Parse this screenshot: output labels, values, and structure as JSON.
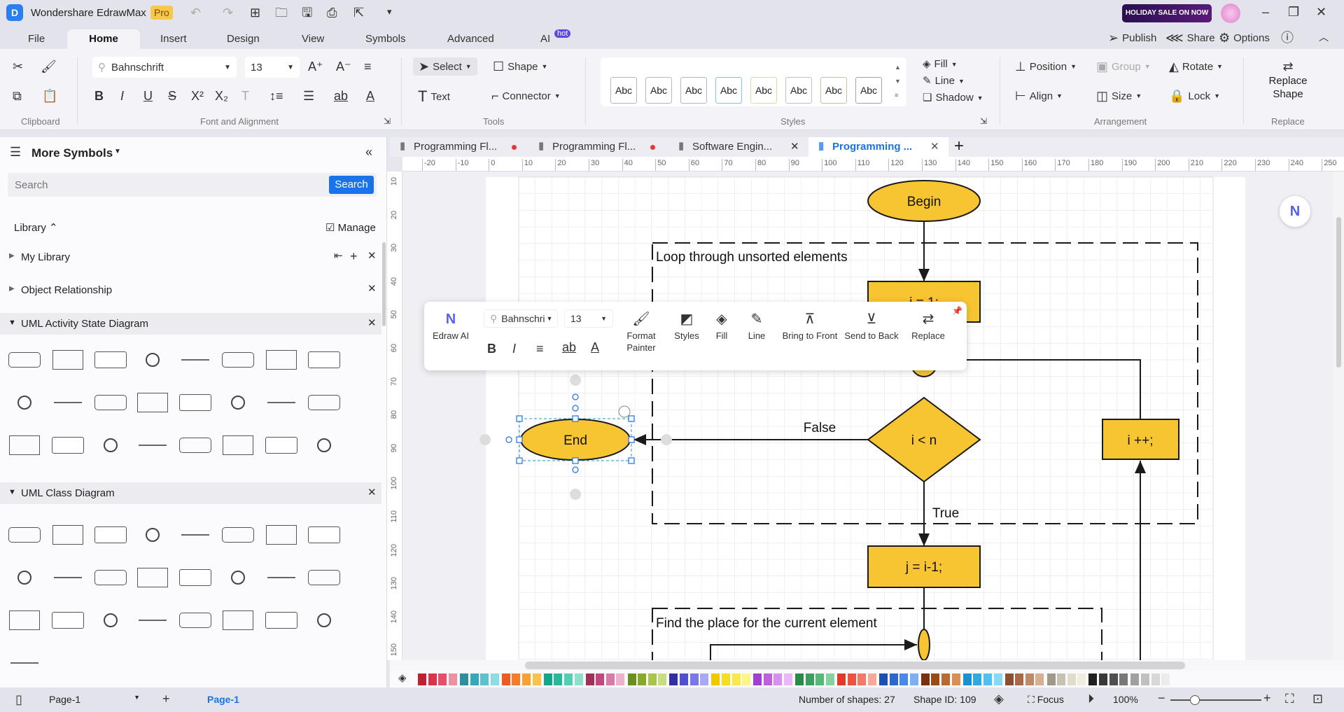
{
  "app": {
    "title": "Wondershare EdrawMax",
    "badge": "Pro",
    "promo": "HOLIDAY SALE ON NOW"
  },
  "menu": {
    "tabs": [
      "File",
      "Home",
      "Insert",
      "Design",
      "View",
      "Symbols",
      "Advanced",
      "AI"
    ],
    "ai_badge": "hot",
    "right": [
      "Publish",
      "Share",
      "Options"
    ]
  },
  "ribbon": {
    "font": "Bahnschrift",
    "size": "13",
    "select": "Select",
    "shape": "Shape",
    "text": "Text",
    "connector": "Connector",
    "styles_sample": "Abc",
    "fill": "Fill",
    "line": "Line",
    "shadow": "Shadow",
    "position": "Position",
    "group": "Group",
    "rotate": "Rotate",
    "align": "Align",
    "sizel": "Size",
    "lock": "Lock",
    "replace_shape_1": "Replace",
    "replace_shape_2": "Shape",
    "groups": [
      "Clipboard",
      "Font and Alignment",
      "Tools",
      "Styles",
      "Arrangement",
      "Replace"
    ]
  },
  "library": {
    "title": "More Symbols",
    "search_placeholder": "Search",
    "search_button": "Search",
    "library_label": "Library",
    "manage": "Manage",
    "items": [
      "My Library",
      "Object Relationship"
    ],
    "sections": [
      "UML Activity State Diagram",
      "UML Class Diagram"
    ]
  },
  "doc_tabs": [
    {
      "label": "Programming Fl...",
      "status": "unsaved"
    },
    {
      "label": "Programming Fl...",
      "status": "unsaved"
    },
    {
      "label": "Software Engin...",
      "status": "close"
    },
    {
      "label": "Programming ...",
      "status": "active"
    }
  ],
  "ruler": {
    "h": [
      "-20",
      "-10",
      "0",
      "10",
      "20",
      "30",
      "40",
      "50",
      "60",
      "70",
      "80",
      "90",
      "100",
      "110",
      "120",
      "130",
      "140",
      "150",
      "160",
      "170",
      "180",
      "190",
      "200",
      "210",
      "220",
      "230",
      "240",
      "250"
    ],
    "v": [
      "10",
      "20",
      "30",
      "40",
      "50",
      "60",
      "70",
      "80",
      "90",
      "100",
      "110",
      "120",
      "130",
      "140",
      "150"
    ]
  },
  "diagram": {
    "begin": "Begin",
    "loop_label": "Loop through unsorted elements",
    "init": "i = 1;",
    "cond": "i < n",
    "end": "End",
    "incr": "i ++;",
    "false_label": "False",
    "true_label": "True",
    "assign": "j = i-1;",
    "find_label": "Find the place for the current element",
    "fill": "#f7c531",
    "stroke": "#1a1a1a"
  },
  "float_toolbar": {
    "ai": "Edraw AI",
    "font": "Bahnschri",
    "size": "13",
    "format1": "Format",
    "format2": "Painter",
    "styles": "Styles",
    "fill": "Fill",
    "line": "Line",
    "front": "Bring to Front",
    "back": "Send to Back",
    "replace": "Replace"
  },
  "palette": [
    "#c0202f",
    "#d9344a",
    "#e64f6a",
    "#f08fa0",
    "#2a8fa0",
    "#38a8b8",
    "#5cc2d0",
    "#8fdbe6",
    "#f05a22",
    "#f57d2a",
    "#f7a033",
    "#fbc24a",
    "#15a58a",
    "#28b89c",
    "#55cdb2",
    "#8ee0cc",
    "#a0305a",
    "#c04a80",
    "#d87aa8",
    "#efb0cc",
    "#6a8f1e",
    "#88a82a",
    "#a8c44a",
    "#c8dc80",
    "#3030a0",
    "#5050d0",
    "#7878e8",
    "#a8a8f4",
    "#f0c800",
    "#f8dc20",
    "#fce848",
    "#fdf48a",
    "#a040d0",
    "#c060e0",
    "#d890f0",
    "#e8b8f8",
    "#2a8a4a",
    "#3aa060",
    "#58b878",
    "#88d0a0",
    "#e03a2a",
    "#f05040",
    "#f47868",
    "#f8a898",
    "#1a50b0",
    "#2a68d0",
    "#4a88e8",
    "#80b0f4",
    "#7a3010",
    "#9a4a18",
    "#b86a30",
    "#d89058",
    "#1a90d0",
    "#30a8e0",
    "#50c0f0",
    "#88d8f8",
    "#8a5030",
    "#a86a48",
    "#c08a68",
    "#d8b090",
    "#a09888",
    "#c8c0b0",
    "#e0dccc",
    "#f0ece0",
    "#202020",
    "#383838",
    "#505050",
    "#787878",
    "#a0a0a0",
    "#c0c0c0",
    "#d8d8d8",
    "#ececec"
  ],
  "status": {
    "page_select": "Page-1",
    "page_tab": "Page-1",
    "shapes": "Number of shapes: 27",
    "shape_id": "Shape ID: 109",
    "focus": "Focus",
    "zoom": "100%"
  },
  "accent": "#1a73e8"
}
